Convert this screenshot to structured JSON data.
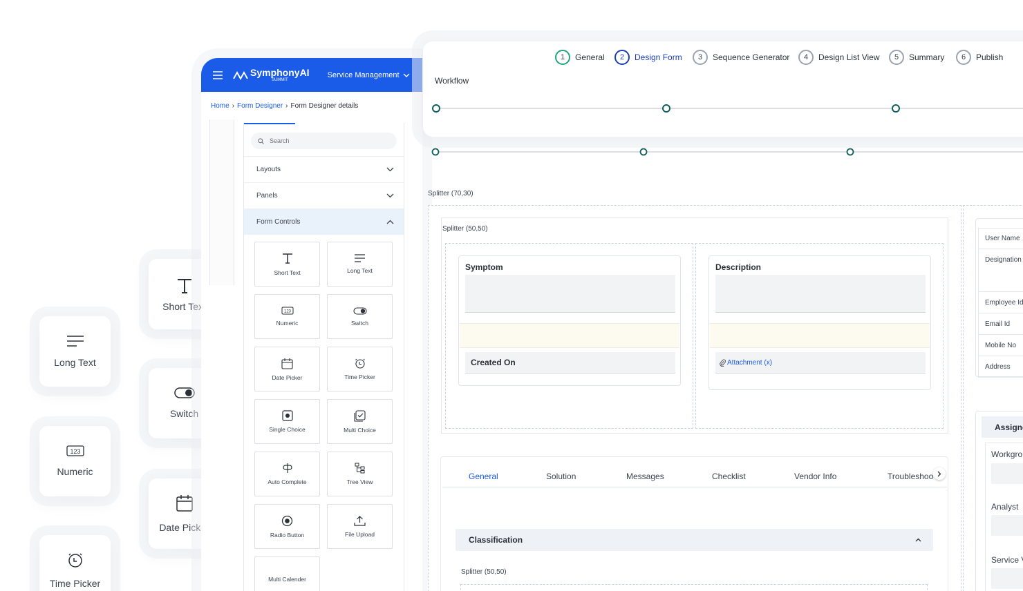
{
  "tiles": {
    "short_text": "Short Text",
    "long_text": "Long Text",
    "switch": "Switch",
    "numeric": "Numeric",
    "date_picker": "Date Picker",
    "time_picker": "Time Picker"
  },
  "app": {
    "brand": "SymphonyAI",
    "brand_sub": "SUMMIT",
    "module": "Service Management",
    "breadcrumb": [
      "Home",
      "Form Designer",
      "Form Designer details"
    ],
    "search_placeholder": "Search",
    "sections": {
      "layouts": "Layouts",
      "panels": "Panels",
      "form_controls": "Form Controls"
    },
    "controls": [
      "Short Text",
      "Long Text",
      "Numeric",
      "Switch",
      "Date Picker",
      "Time Picker",
      "Single Choice",
      "Multi Choice",
      "Auto Complete",
      "Tree View",
      "Radio Button",
      "File Upload",
      "Multi Calender"
    ]
  },
  "steps": [
    {
      "num": "1",
      "label": "General",
      "state": "done"
    },
    {
      "num": "2",
      "label": "Design Form",
      "state": "active"
    },
    {
      "num": "3",
      "label": "Sequence Generator",
      "state": "todo"
    },
    {
      "num": "4",
      "label": "Design List View",
      "state": "todo"
    },
    {
      "num": "5",
      "label": "Summary",
      "state": "todo"
    },
    {
      "num": "6",
      "label": "Publish",
      "state": "todo"
    }
  ],
  "workflow": {
    "label": "Workflow"
  },
  "canvas": {
    "outer_splitter": "Splitter (70,30)",
    "inner_splitter": "Splitter (50,50)",
    "symptom": "Symptom",
    "created_on": "Created On",
    "description": "Description",
    "attachment": "Attachment (x)",
    "tabs": [
      "General",
      "Solution",
      "Messages",
      "Checklist",
      "Vendor Info",
      "Troubleshoo"
    ],
    "classification": "Classification",
    "lower_splitter": "Splitter (50,50)",
    "right_fields": [
      "User Name",
      "Designation",
      "Employee Id",
      "Email Id",
      "Mobile No",
      "Address"
    ],
    "assign_title": "Assigne",
    "assign_fields": [
      "Workgro",
      "Analyst",
      "Service V"
    ]
  },
  "colors": {
    "brand": "#1a5be8",
    "green": "#1fa67a",
    "teal": "#0f5e5e"
  }
}
